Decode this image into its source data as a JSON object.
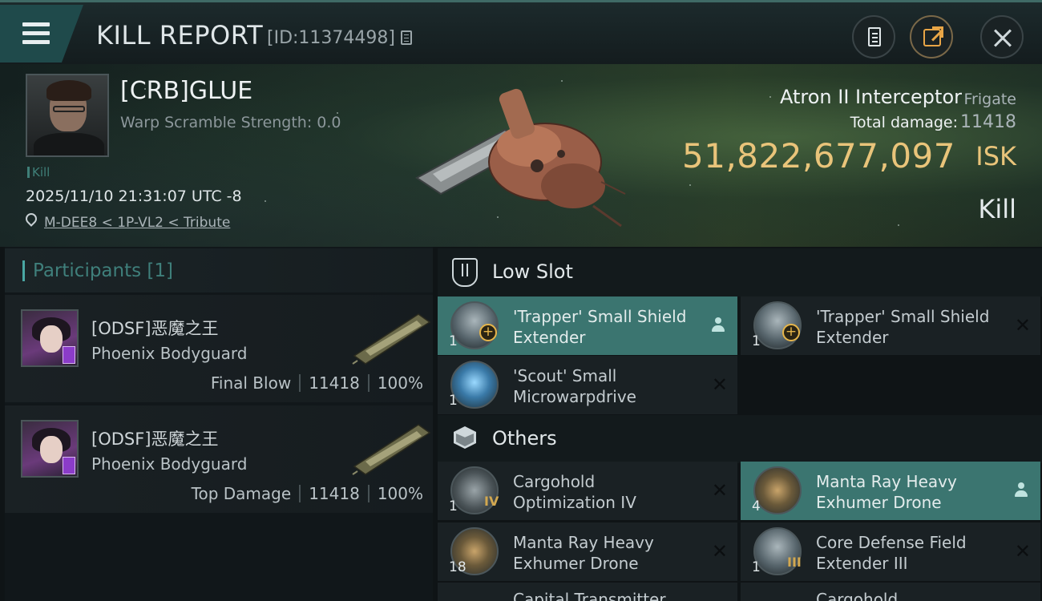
{
  "header": {
    "title": "KILL REPORT",
    "report_id": "[ID:11374498]"
  },
  "victim": {
    "name": "[CRB]GLUE",
    "warp_scramble": "Warp Scramble Strength: 0.0",
    "tag": "Kill",
    "timestamp": "2025/11/10 21:31:07 UTC -8",
    "location": "M-DEE8 < 1P-VL2 < Tribute",
    "ship_name": "Atron II Interceptor",
    "ship_class": "Frigate",
    "damage_label": "Total damage:",
    "damage_value": "11418",
    "isk_value": "51,822,677,097",
    "isk_unit": "ISK",
    "result": "Kill"
  },
  "participants": {
    "label": "Participants [1]",
    "items": [
      {
        "name": "[ODSF]恶魔之王",
        "ship": "Phoenix Bodyguard",
        "role": "Final Blow",
        "damage": "11418",
        "percent": "100%"
      },
      {
        "name": "[ODSF]恶魔之王",
        "ship": "Phoenix Bodyguard",
        "role": "Top Damage",
        "damage": "11418",
        "percent": "100%"
      }
    ]
  },
  "slots": {
    "low": {
      "label": "Low Slot",
      "items": [
        {
          "name": "'Trapper' Small Shield Extender",
          "qty": "1",
          "status": "dropped"
        },
        {
          "name": "'Trapper' Small Shield Extender",
          "qty": "1",
          "status": "destroyed"
        },
        {
          "name": "'Scout' Small Microwarpdrive",
          "qty": "1",
          "status": "destroyed"
        }
      ]
    },
    "others": {
      "label": "Others",
      "items": [
        {
          "name": "Cargohold Optimization IV",
          "qty": "1",
          "tier": "IV",
          "status": "destroyed"
        },
        {
          "name": "Manta Ray Heavy Exhumer Drone",
          "qty": "4",
          "status": "dropped"
        },
        {
          "name": "Manta Ray Heavy Exhumer Drone",
          "qty": "18",
          "status": "destroyed"
        },
        {
          "name": "Core Defense Field Extender III",
          "qty": "1",
          "tier": "III",
          "status": "destroyed"
        },
        {
          "name": "Capital Transmitter",
          "qty": ""
        },
        {
          "name": "Cargohold ...",
          "qty": ""
        }
      ]
    }
  },
  "colors": {
    "accent_teal": "#3b7570",
    "isk_gold": "#e9c47a",
    "share_orange": "#e8a546"
  },
  "icons": {
    "menu": "menu-icon",
    "copy": "copy-icon",
    "clipboard": "clipboard-icon",
    "share": "share-icon",
    "close": "close-icon",
    "location": "location-pin-icon",
    "low_slot": "low-slot-icon",
    "others": "cube-icon",
    "dropped": "person-icon",
    "destroyed": "x-icon"
  }
}
